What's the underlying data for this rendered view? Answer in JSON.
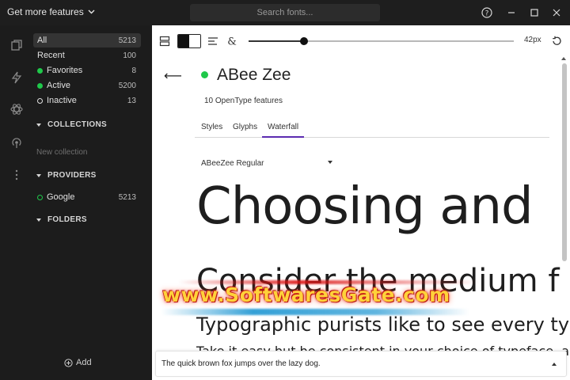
{
  "titlebar": {
    "get_more_label": "Get more features",
    "search_placeholder": "Search fonts..."
  },
  "sidebar": {
    "filters": [
      {
        "label": "All",
        "count": "5213",
        "marker": "none",
        "active": true
      },
      {
        "label": "Recent",
        "count": "100",
        "marker": "none",
        "active": false
      },
      {
        "label": "Favorites",
        "count": "8",
        "marker": "green-dot",
        "active": false
      },
      {
        "label": "Active",
        "count": "5200",
        "marker": "green-dot",
        "active": false
      },
      {
        "label": "Inactive",
        "count": "13",
        "marker": "ring",
        "active": false
      }
    ],
    "collections_label": "COLLECTIONS",
    "new_collection_label": "New collection",
    "providers_label": "PROVIDERS",
    "providers": [
      {
        "label": "Google",
        "count": "5213",
        "marker": "green-ring"
      }
    ],
    "folders_label": "FOLDERS",
    "add_label": "Add"
  },
  "toolbar": {
    "size_readout": "42px",
    "size_slider_fraction": 0.21
  },
  "font": {
    "name": "ABee Zee",
    "features": "10 OpenType features",
    "status_color": "#1fc84a"
  },
  "tabs": [
    {
      "label": "Styles",
      "active": false
    },
    {
      "label": "Glyphs",
      "active": false
    },
    {
      "label": "Waterfall",
      "active": true
    }
  ],
  "style_select": {
    "value": "ABeeZee Regular"
  },
  "waterfall": [
    "Choosing and",
    "Consider the medium f",
    "Typographic purists like to see every typ",
    "Take it easy but be consistent in your choice of typeface, al"
  ],
  "preview": {
    "text": "The quick brown fox jumps over the lazy dog."
  },
  "watermark": {
    "text": "www.SoftwaresGate.com"
  },
  "colors": {
    "accent": "#5b2bb0",
    "active_green": "#1fc84a",
    "sidebar_bg": "#1c1c1c"
  }
}
